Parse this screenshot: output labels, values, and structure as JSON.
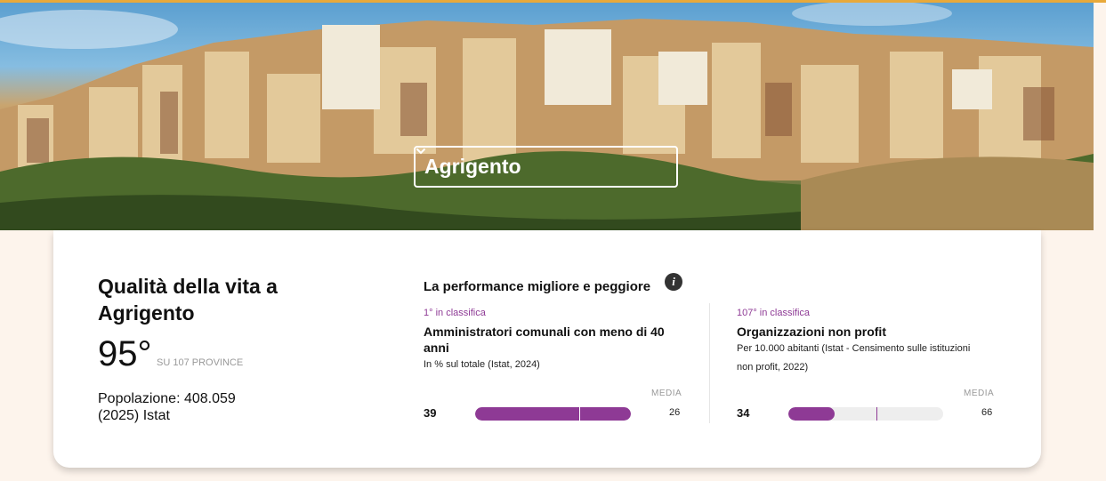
{
  "province_selector": {
    "value": "Agrigento"
  },
  "summary": {
    "title": "Qualità della vita a Agrigento",
    "rank": "95°",
    "rank_suffix": "SU 107 PROVINCE",
    "population": "Popolazione: 408.059 (2025) Istat"
  },
  "performance": {
    "title": "La performance migliore e peggiore",
    "best": {
      "rank_label": "1° in classifica",
      "indicator": "Amministratori comunali con meno di 40 anni",
      "description": "In % sul totale (Istat, 2024)",
      "media_label": "MEDIA",
      "value": "39",
      "average": "26",
      "bar_fill_fraction": 1.0,
      "avg_marker_fraction": 0.67
    },
    "worst": {
      "rank_label": "107° in classifica",
      "indicator": "Organizzazioni non profit",
      "description": "Per 10.000 abitanti (Istat - Censimento sulle istituzioni non profit, 2022)",
      "media_label": "MEDIA",
      "value": "34",
      "average": "66",
      "bar_fill_fraction": 0.3,
      "avg_marker_fraction": 0.57
    }
  },
  "colors": {
    "accent": "#8e3a95",
    "top_border": "#e8a93a",
    "page_bg": "#fdf4ec"
  }
}
